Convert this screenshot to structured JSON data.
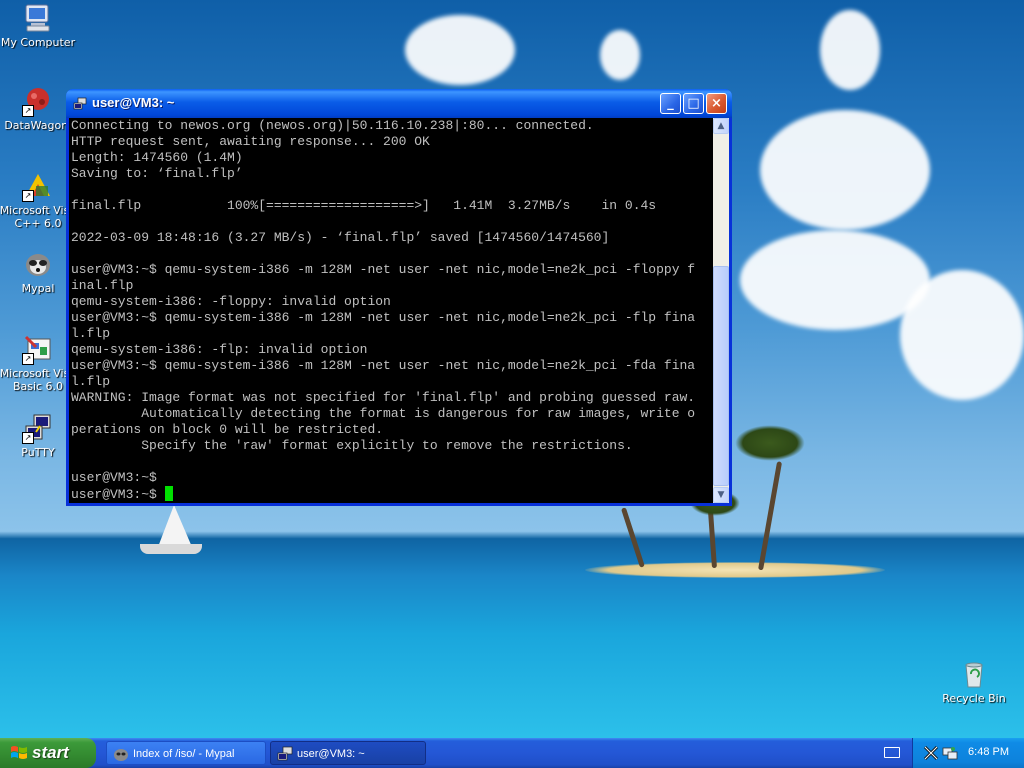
{
  "desktop_icons": [
    {
      "label": "My Computer",
      "icon": "my-computer-icon"
    },
    {
      "label": "DataWagon.",
      "icon": "datawagon-icon"
    },
    {
      "label": "Microsoft Visual C++ 6.0",
      "line1": "Microsoft Visu",
      "line2": "C++ 6.0",
      "icon": "visual-cpp-icon"
    },
    {
      "label": "Mypal",
      "icon": "mypal-icon"
    },
    {
      "label": "Microsoft Visual Basic 6.0",
      "line1": "Microsoft Visu",
      "line2": "Basic 6.0",
      "icon": "visual-basic-icon"
    },
    {
      "label": "PuTTY",
      "icon": "putty-icon"
    },
    {
      "label": "Recycle Bin",
      "icon": "recycle-bin-icon"
    }
  ],
  "window": {
    "title": "user@VM3: ~",
    "buttons": {
      "minimize": "_",
      "maximize": "□",
      "close": "×"
    }
  },
  "terminal": {
    "lines": [
      "Connecting to newos.org (newos.org)|50.116.10.238|:80... connected.",
      "HTTP request sent, awaiting response... 200 OK",
      "Length: 1474560 (1.4M)",
      "Saving to: ‘final.flp’",
      "",
      "final.flp           100%[===================>]   1.41M  3.27MB/s    in 0.4s",
      "",
      "2022-03-09 18:48:16 (3.27 MB/s) - ‘final.flp’ saved [1474560/1474560]",
      "",
      "user@VM3:~$ qemu-system-i386 -m 128M -net user -net nic,model=ne2k_pci -floppy f",
      "inal.flp",
      "qemu-system-i386: -floppy: invalid option",
      "user@VM3:~$ qemu-system-i386 -m 128M -net user -net nic,model=ne2k_pci -flp fina",
      "l.flp",
      "qemu-system-i386: -flp: invalid option",
      "user@VM3:~$ qemu-system-i386 -m 128M -net user -net nic,model=ne2k_pci -fda fina",
      "l.flp",
      "WARNING: Image format was not specified for 'final.flp' and probing guessed raw.",
      "         Automatically detecting the format is dangerous for raw images, write o",
      "perations on block 0 will be restricted.",
      "         Specify the 'raw' format explicitly to remove the restrictions.",
      "",
      "user@VM3:~$"
    ],
    "prompt": "user@VM3:~$ ",
    "cursor_color": "#00e000"
  },
  "scrollbar": {
    "up": "▲",
    "down": "▼",
    "position": 1.0
  },
  "taskbar": {
    "start_label": "start",
    "tasks": [
      {
        "label": "Index of /iso/ - Mypal",
        "active": false,
        "icon": "mypal-icon"
      },
      {
        "label": "user@VM3: ~",
        "active": true,
        "icon": "putty-icon"
      }
    ],
    "clock": "6:48 PM",
    "tray_icons": [
      "keyboard-icon",
      "x-server-icon",
      "network-icon"
    ]
  }
}
